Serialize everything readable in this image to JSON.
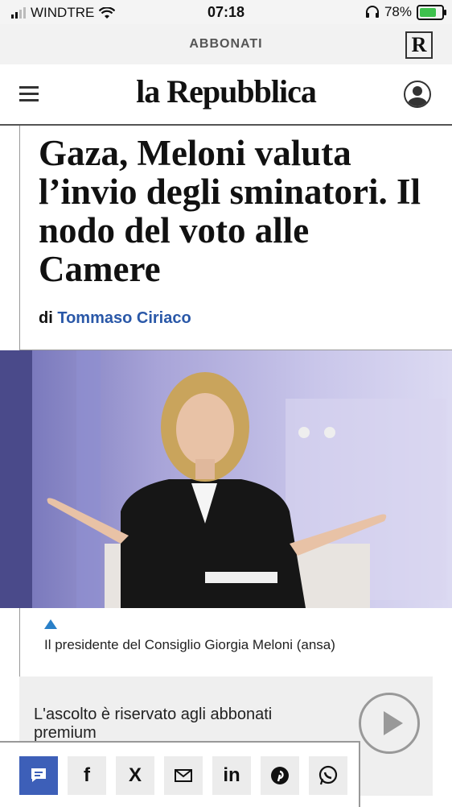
{
  "status_bar": {
    "carrier": "WINDTRE",
    "time": "07:18",
    "battery": "78%",
    "battery_level": 0.78
  },
  "subscription_bar": {
    "label": "ABBONATI",
    "logo_letter": "R"
  },
  "header": {
    "brand": "la Repubblica"
  },
  "article": {
    "headline": "Gaza, Meloni valuta l’invio degli sminatori. Il nodo del voto alle Camere",
    "byline_prefix": "di",
    "author": "Tommaso Ciriaco",
    "caption": "Il presidente del Consiglio Giorgia Meloni (ansa)"
  },
  "audio": {
    "message": "L'ascolto è riservato agli abbonati premium"
  },
  "share": {
    "comment_icon": "comment-icon",
    "facebook": "f",
    "x": "X",
    "email_icon": "mail-icon",
    "linkedin": "in",
    "pinterest_icon": "pinterest-icon",
    "whatsapp_icon": "whatsapp-icon"
  },
  "colors": {
    "accent": "#2a58a8",
    "comment_button": "#3d5fb8",
    "battery": "#3ec14d"
  }
}
